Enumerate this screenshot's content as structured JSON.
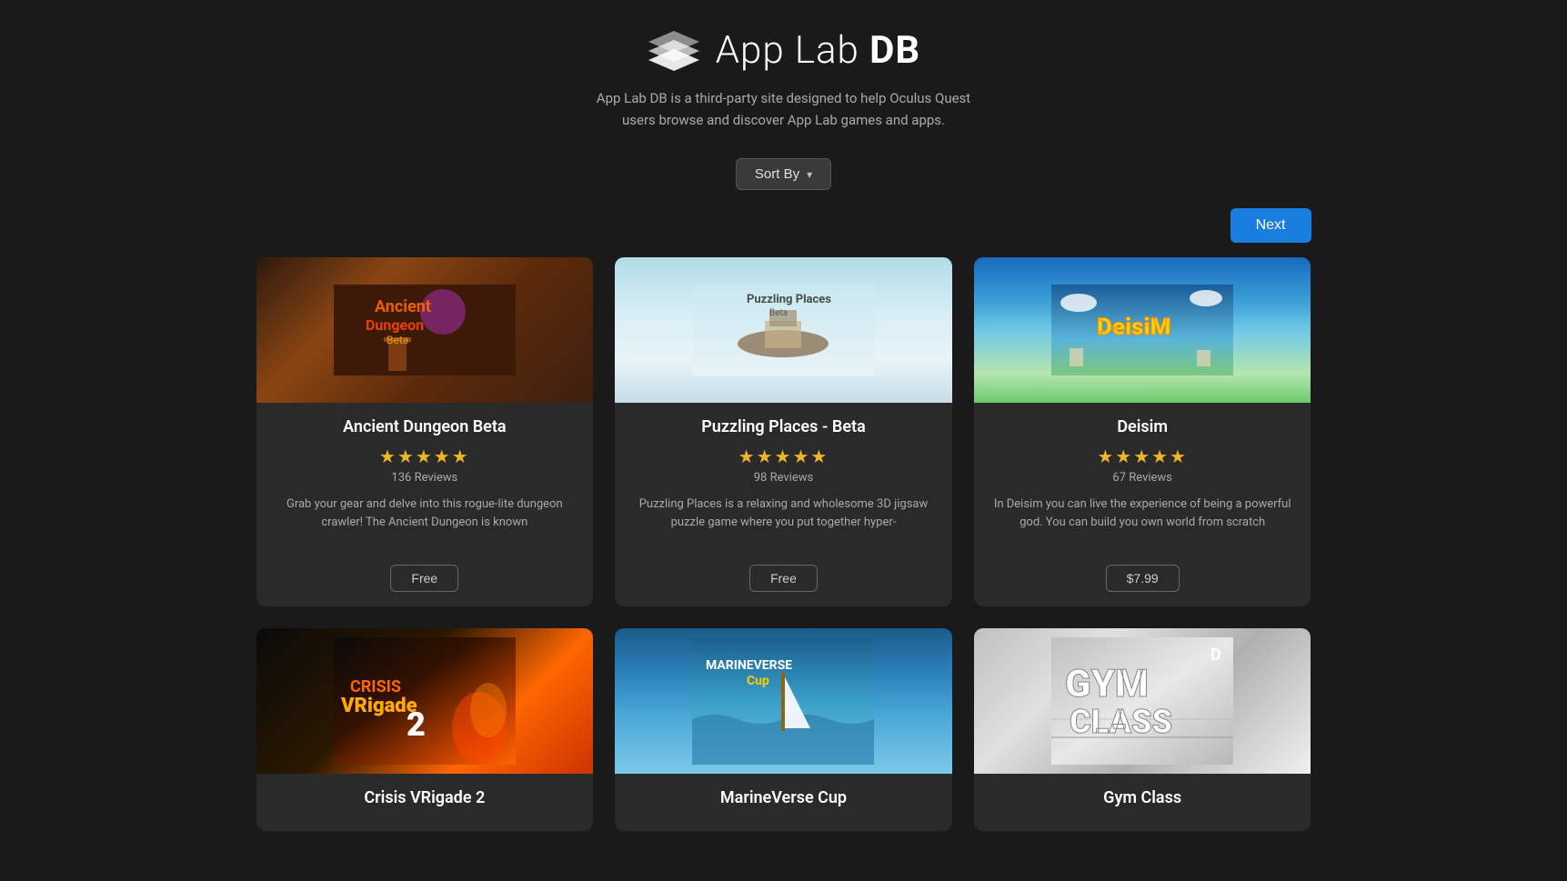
{
  "header": {
    "logo_text_light": "App Lab ",
    "logo_text_bold": "DB",
    "tagline_line1": "App Lab DB is a third-party site designed to help Oculus Quest",
    "tagline_line2": "users browse and discover App Lab games and apps."
  },
  "controls": {
    "sort_label": "Sort By",
    "next_label": "Next"
  },
  "games": [
    {
      "id": "ancient-dungeon-beta",
      "title": "Ancient Dungeon Beta",
      "stars": "★★★★★",
      "reviews": "136 Reviews",
      "description": "Grab your gear and delve into this rogue-lite dungeon crawler! The Ancient Dungeon is known",
      "price": "Free",
      "image_type": "ancient"
    },
    {
      "id": "puzzling-places-beta",
      "title": "Puzzling Places - Beta",
      "stars": "★★★★★",
      "reviews": "98 Reviews",
      "description": "Puzzling Places is a relaxing and wholesome 3D jigsaw puzzle game where you put together hyper-",
      "price": "Free",
      "image_type": "puzzling"
    },
    {
      "id": "deisim",
      "title": "Deisim",
      "stars": "★★★★★",
      "reviews": "67 Reviews",
      "description": "In Deisim you can live the experience of being a powerful god. You can build you own world from scratch",
      "price": "$7.99",
      "image_type": "deisim"
    },
    {
      "id": "crisis-vrigade-2",
      "title": "Crisis VRigade 2",
      "stars": "",
      "reviews": "",
      "description": "",
      "price": "",
      "image_type": "crisis"
    },
    {
      "id": "marineverse-cup",
      "title": "MarineVerse Cup",
      "stars": "",
      "reviews": "",
      "description": "",
      "price": "",
      "image_type": "marineverse"
    },
    {
      "id": "gym-class",
      "title": "Gym Class",
      "stars": "",
      "reviews": "",
      "description": "",
      "price": "",
      "image_type": "gymclass"
    }
  ]
}
